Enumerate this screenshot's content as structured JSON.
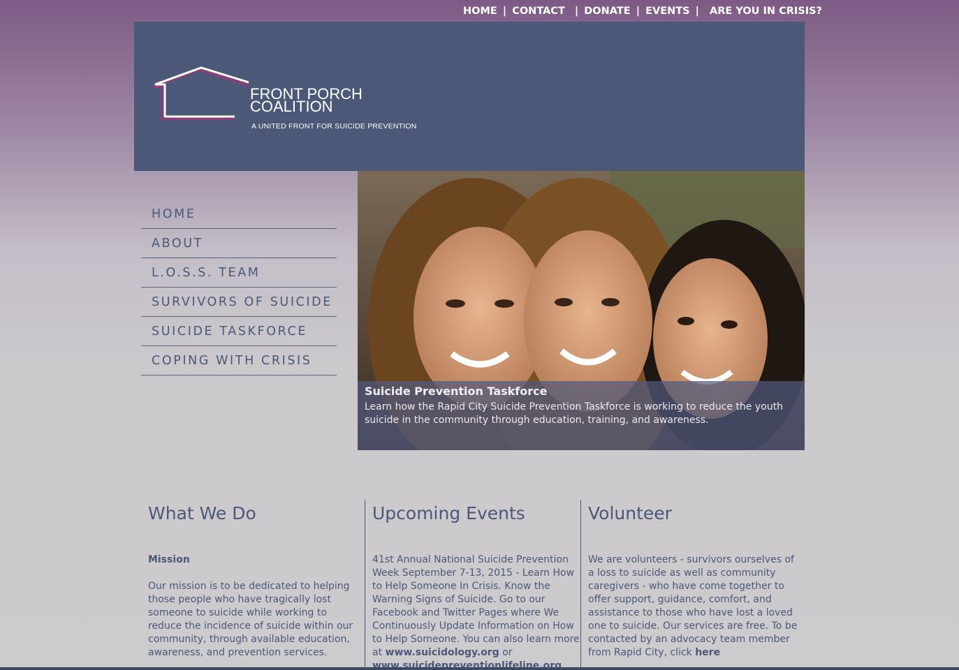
{
  "top_nav": {
    "items": [
      "HOME",
      "CONTACT",
      "DONATE",
      "EVENTS",
      "ARE YOU IN CRISIS?"
    ],
    "separator": "|"
  },
  "logo": {
    "name_line1": "FRONT PORCH",
    "name_line2": "COALITION",
    "tagline": "A UNITED FRONT FOR SUICIDE PREVENTION"
  },
  "side_nav": {
    "items": [
      "HOME",
      "ABOUT",
      "L.O.S.S. TEAM",
      "SURVIVORS OF SUICIDE",
      "SUICIDE TASKFORCE",
      "COPING WITH CRISIS"
    ]
  },
  "hero": {
    "caption_title": "Suicide Prevention Taskforce",
    "caption_text": "Learn how the Rapid City Suicide Prevention Taskforce is working to reduce the youth suicide in the community through education, training, and awareness."
  },
  "columns": {
    "what_we_do": {
      "heading": "What We Do",
      "subheading": "Mission",
      "text": "Our mission is to be dedicated to helping those people who have tragically lost someone to suicide while working to reduce the incidence of suicide within our community, through available education, awareness, and prevention services."
    },
    "events": {
      "heading": "Upcoming Events",
      "text": "41st Annual National Suicide Prevention Week September 7-13, 2015 - Learn How to Help Someone In Crisis. Know the Warning Signs of Suicide. Go to our Facebook and Twitter Pages where We Continuously Update Information on How to Help Someone. You can also learn more at",
      "link1": "www.suicidology.org",
      "or": "or",
      "link2": "www.suicidepreventionlifeline.org"
    },
    "volunteer": {
      "heading": "Volunteer",
      "text": "We are volunteers - survivors ourselves of a loss to suicide as well as community caregivers - who have come together to offer support, guidance, comfort, and assistance to those who have lost a loved one to suicide. Our services are free. To be contacted by an advocacy team member from Rapid City, click",
      "link": "here"
    }
  },
  "colors": {
    "header_bg": "#4b5877",
    "nav_text": "#4b5877",
    "page_top": "#7d5a85",
    "page_bottom": "#cccbcd"
  }
}
